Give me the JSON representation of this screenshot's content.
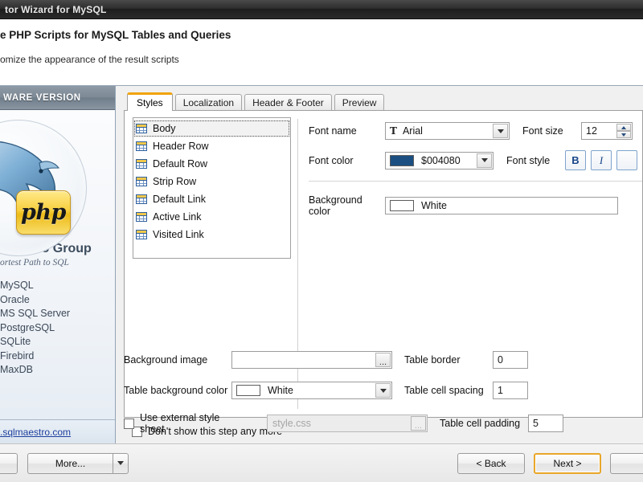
{
  "window": {
    "title": "tor Wizard for MySQL"
  },
  "header": {
    "title": "e PHP Scripts for MySQL Tables and Queries",
    "subtitle": "omize the appearance of the result scripts"
  },
  "sidebar": {
    "banner": "WARE VERSION",
    "logo_text": "php",
    "brand": "Maestro Group",
    "tagline": "ortest Path to SQL",
    "databases": [
      "MySQL",
      "Oracle",
      "MS SQL Server",
      "PostgreSQL",
      "SQLite",
      "Firebird",
      "MaxDB"
    ],
    "link": ".sqlmaestro.com"
  },
  "tabs": [
    {
      "label": "Styles",
      "active": true
    },
    {
      "label": "Localization",
      "active": false
    },
    {
      "label": "Header & Footer",
      "active": false
    },
    {
      "label": "Preview",
      "active": false
    }
  ],
  "style_list": {
    "items": [
      {
        "label": "Body",
        "selected": true
      },
      {
        "label": "Header Row",
        "selected": false
      },
      {
        "label": "Default Row",
        "selected": false
      },
      {
        "label": "Strip Row",
        "selected": false
      },
      {
        "label": "Default Link",
        "selected": false
      },
      {
        "label": "Active Link",
        "selected": false
      },
      {
        "label": "Visited Link",
        "selected": false
      }
    ]
  },
  "form": {
    "font_name_label": "Font name",
    "font_name_value": "Arial",
    "font_size_label": "Font size",
    "font_size_value": "12",
    "font_color_label": "Font color",
    "font_color_value": "$004080",
    "font_color_hex": "#1b4f82",
    "font_style_label": "Font style",
    "font_style_bold": "B",
    "font_style_italic": "I",
    "background_color_label": "Background color",
    "background_color_value": "White",
    "background_color_hex": "#ffffff",
    "background_image_label": "Background image",
    "background_image_value": "",
    "table_bg_label": "Table background color",
    "table_bg_value": "White",
    "table_bg_hex": "#ffffff",
    "external_css_label": "Use external style sheet",
    "external_css_checked": false,
    "external_css_value": "style.css",
    "table_border_label": "Table border",
    "table_border_value": "0",
    "table_cell_spacing_label": "Table cell spacing",
    "table_cell_spacing_value": "1",
    "table_cell_padding_label": "Table cell padding",
    "table_cell_padding_value": "5",
    "browse_glyph": "..."
  },
  "bottom": {
    "dont_show_label": "Don't show this step any more",
    "dont_show_checked": false,
    "more_label": "More...",
    "back_label": "< Back",
    "next_label": "Next >"
  },
  "colors": {
    "accent": "#f0a30a",
    "default_button_border": "#e9a729",
    "link": "#1e3f9e"
  }
}
